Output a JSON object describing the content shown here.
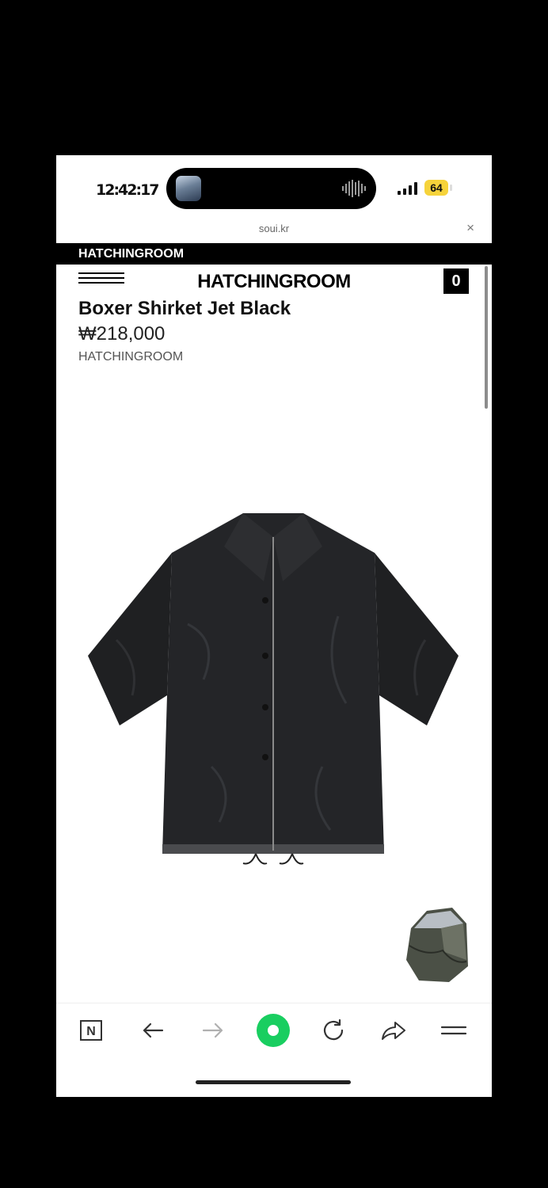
{
  "status_bar": {
    "time": "12:42:17",
    "battery": "64"
  },
  "browser": {
    "url": "soui.kr",
    "close_icon": "×"
  },
  "site": {
    "top_strip": "HATCHINGROOM",
    "logo": "HATCHINGROOM",
    "cart_count": "0"
  },
  "product": {
    "title": "Boxer Shirket Jet Black",
    "price": "₩218,000",
    "brand": "HATCHINGROOM"
  },
  "toolbar": {
    "n_label": "N",
    "items": [
      "naver-icon",
      "back-icon",
      "forward-icon",
      "home-icon",
      "reload-icon",
      "share-icon",
      "menu-icon"
    ]
  },
  "colors": {
    "accent_green": "#19ce60",
    "battery_yellow": "#f6d33b"
  }
}
